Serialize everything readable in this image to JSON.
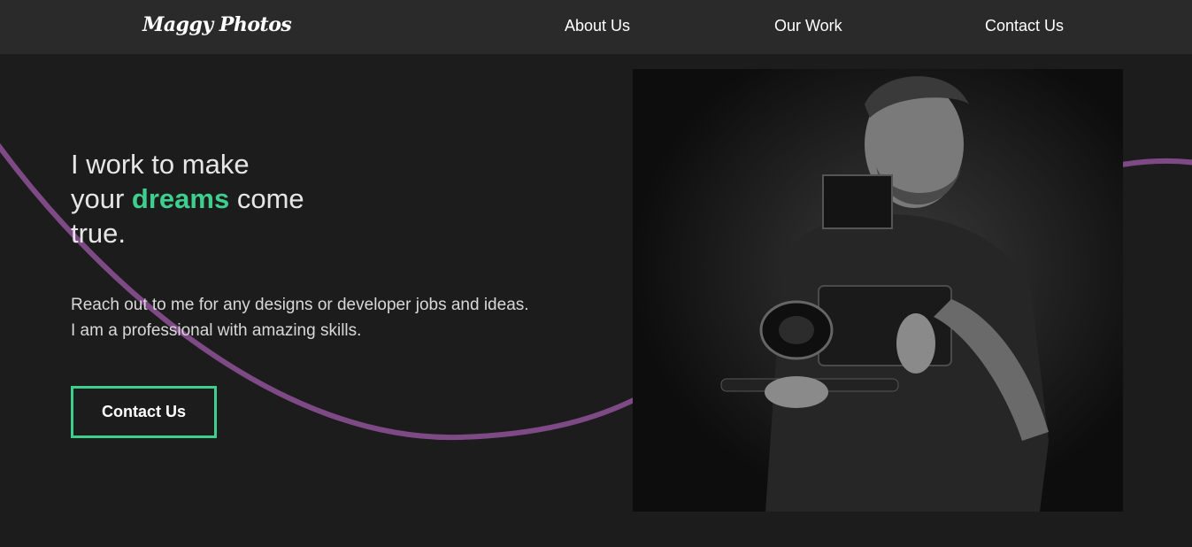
{
  "navbar": {
    "logo": "Maggy Photos",
    "links": [
      {
        "label": "About Us"
      },
      {
        "label": "Our Work"
      },
      {
        "label": "Contact Us"
      }
    ]
  },
  "hero": {
    "headline_line1": "I work to make",
    "headline_pre": "your ",
    "headline_accent": "dreams",
    "headline_post": " come",
    "headline_line3": "true.",
    "subtext_line1": "Reach out to me for any designs or developer jobs and ideas.",
    "subtext_line2": "I am a professional with amazing skills.",
    "cta_label": "Contact Us",
    "photo_alt": "Photographer holding a cinema camera rig"
  },
  "colors": {
    "background": "#1c1c1c",
    "navbar": "#2a2a2a",
    "accent_green": "#3ecf8e",
    "curve_purple": "#7e4a86"
  }
}
